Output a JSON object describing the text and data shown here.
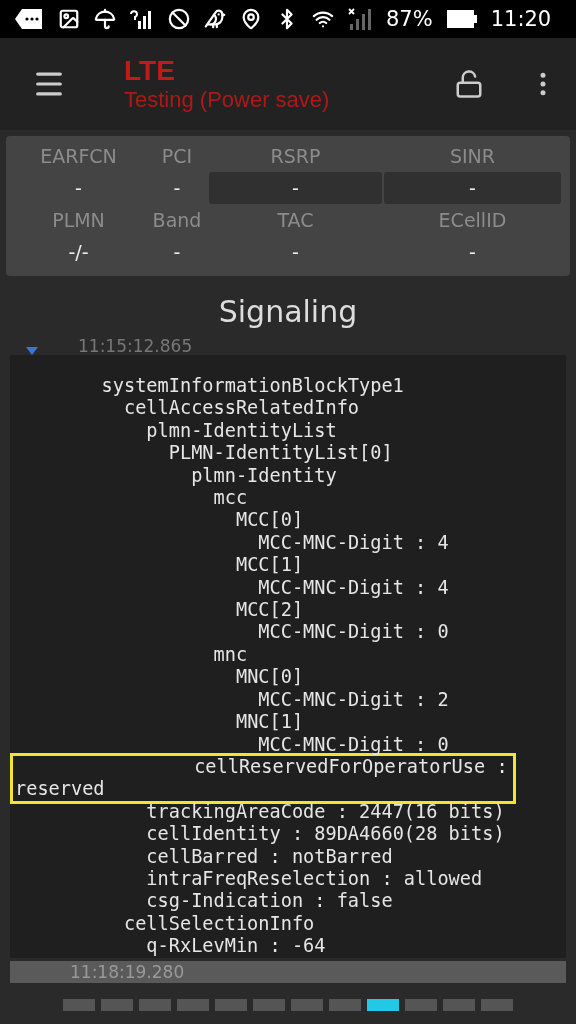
{
  "status_bar": {
    "battery": "87%",
    "time": "11:20"
  },
  "app_bar": {
    "title": "LTE",
    "subtitle": "Testing (Power save)"
  },
  "cell_info": {
    "rows": [
      [
        {
          "label": "EARFCN",
          "value": "-",
          "boxed": false
        },
        {
          "label": "PCI",
          "value": "-",
          "boxed": false
        },
        {
          "label": "RSRP",
          "value": "-",
          "boxed": true
        },
        {
          "label": "SINR",
          "value": "-",
          "boxed": true
        }
      ],
      [
        {
          "label": "PLMN",
          "value": "-/-",
          "boxed": false
        },
        {
          "label": "Band",
          "value": "-",
          "boxed": false
        },
        {
          "label": "TAC",
          "value": "-",
          "boxed": false
        },
        {
          "label": "ECellID",
          "value": "-",
          "boxed": false
        }
      ]
    ]
  },
  "section_title": "Signaling",
  "message_list": {
    "top_time": "11:15:12.865",
    "bottom_time": "11:18:19.280"
  },
  "decoded_message": {
    "tree": [
      {
        "text": "systemInformationBlockType1",
        "highlighted": false,
        "children": [
          {
            "text": "cellAccessRelatedInfo",
            "highlighted": false,
            "children": [
              {
                "text": "plmn-IdentityList",
                "highlighted": false,
                "children": [
                  {
                    "text": "PLMN-IdentityList[0]",
                    "highlighted": false,
                    "children": [
                      {
                        "text": "plmn-Identity",
                        "highlighted": false,
                        "children": [
                          {
                            "text": "mcc",
                            "highlighted": false,
                            "children": [
                              {
                                "text": "MCC[0]",
                                "highlighted": false,
                                "children": [
                                  {
                                    "text": "MCC-MNC-Digit : 4",
                                    "highlighted": false
                                  }
                                ]
                              },
                              {
                                "text": "MCC[1]",
                                "highlighted": false,
                                "children": [
                                  {
                                    "text": "MCC-MNC-Digit : 4",
                                    "highlighted": false
                                  }
                                ]
                              },
                              {
                                "text": "MCC[2]",
                                "highlighted": false,
                                "children": [
                                  {
                                    "text": "MCC-MNC-Digit : 0",
                                    "highlighted": false
                                  }
                                ]
                              }
                            ]
                          },
                          {
                            "text": "mnc",
                            "highlighted": false,
                            "children": [
                              {
                                "text": "MNC[0]",
                                "highlighted": false,
                                "children": [
                                  {
                                    "text": "MCC-MNC-Digit : 2",
                                    "highlighted": false
                                  }
                                ]
                              },
                              {
                                "text": "MNC[1]",
                                "highlighted": false,
                                "children": [
                                  {
                                    "text": "MCC-MNC-Digit : 0",
                                    "highlighted": false
                                  }
                                ]
                              }
                            ]
                          }
                        ]
                      },
                      {
                        "text": "cellReservedForOperatorUse : reserved",
                        "highlighted": true
                      }
                    ]
                  }
                ]
              },
              {
                "text": "trackingAreaCode : 2447(16 bits)",
                "highlighted": false
              },
              {
                "text": "cellIdentity : 89DA4660(28 bits)",
                "highlighted": false
              },
              {
                "text": "cellBarred : notBarred",
                "highlighted": false
              },
              {
                "text": "intraFreqReselection : allowed",
                "highlighted": false
              },
              {
                "text": "csg-Indication : false",
                "highlighted": false
              }
            ]
          },
          {
            "text": "cellSelectionInfo",
            "highlighted": false,
            "children": [
              {
                "text": "q-RxLevMin : -64",
                "highlighted": false
              }
            ]
          }
        ]
      }
    ]
  },
  "pager": [
    {
      "selected": false
    },
    {
      "selected": false
    },
    {
      "selected": false
    },
    {
      "selected": false
    },
    {
      "selected": false
    },
    {
      "selected": false
    },
    {
      "selected": false
    },
    {
      "selected": false
    },
    {
      "selected": true
    },
    {
      "selected": false
    },
    {
      "selected": false
    },
    {
      "selected": false
    }
  ]
}
